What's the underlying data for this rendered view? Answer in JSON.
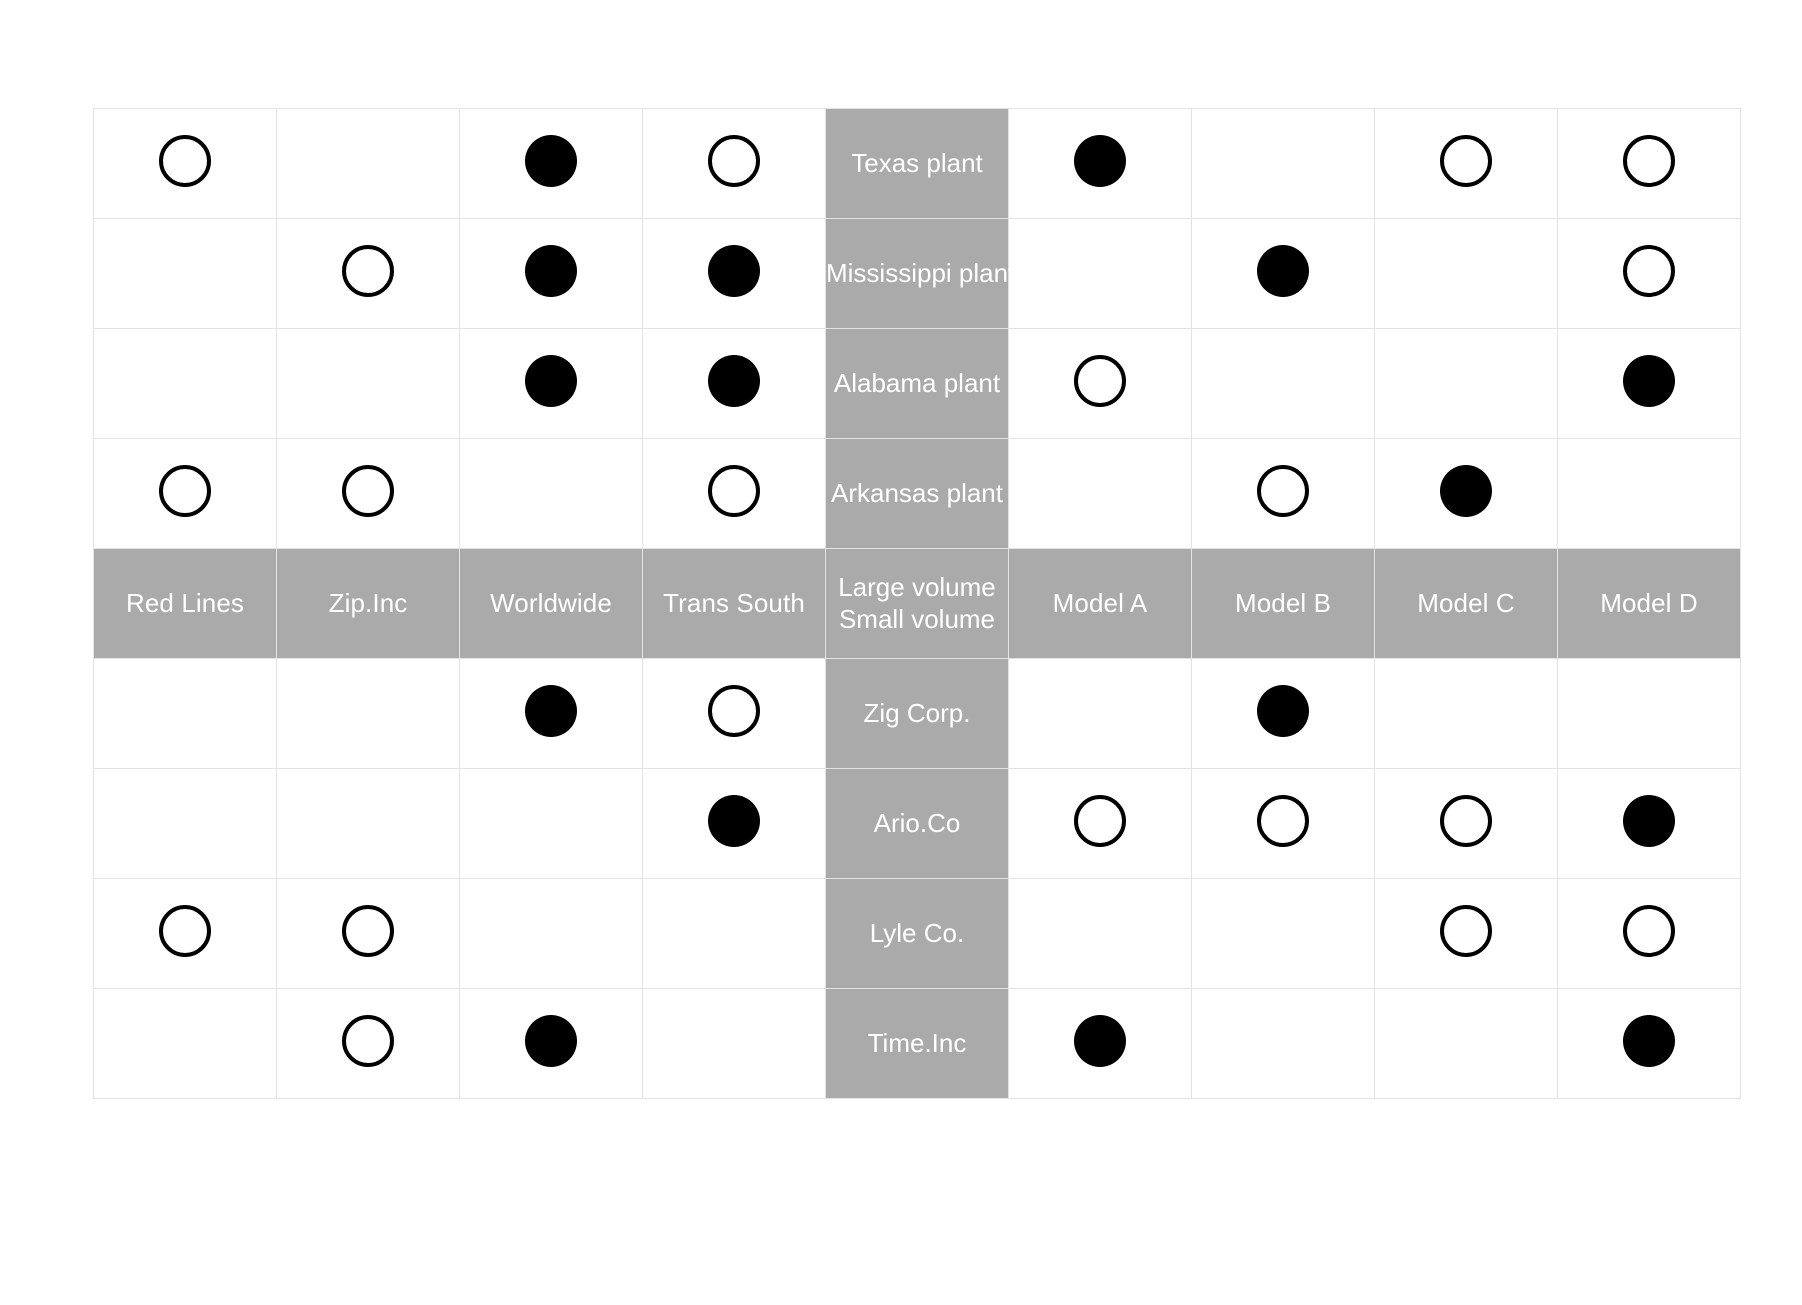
{
  "diagram": {
    "kind": "comparison-matrix",
    "colors": {
      "header_background": "#aaaaaa",
      "header_text": "#ffffff",
      "grid_line": "#e3e3e3",
      "marker_filled": "#000000",
      "marker_open_stroke": "#000000",
      "page_background": "#ffffff"
    },
    "marker_legend": {
      "filled": "filled-circle",
      "open": "open-circle",
      "none": "empty-cell"
    }
  },
  "center_column": {
    "header_line_1": "Large volume",
    "header_line_2": "Small volume",
    "top_labels": [
      "Texas plant",
      "Mississippi plant",
      "Alabama plant",
      "Arkansas plant"
    ],
    "bottom_labels": [
      "Zig Corp.",
      "Ario.Co",
      "Lyle Co.",
      "Time.Inc"
    ]
  },
  "left_columns": [
    "Red Lines",
    "Zip.Inc",
    "Worldwide",
    "Trans South"
  ],
  "right_columns": [
    "Model A",
    "Model B",
    "Model C",
    "Model D"
  ],
  "rows": [
    {
      "label": "Texas plant",
      "section": "top",
      "left": [
        "open",
        "none",
        "filled",
        "open"
      ],
      "right": [
        "filled",
        "none",
        "open",
        "open"
      ]
    },
    {
      "label": "Mississippi plant",
      "section": "top",
      "left": [
        "none",
        "open",
        "filled",
        "filled"
      ],
      "right": [
        "none",
        "filled",
        "none",
        "open"
      ]
    },
    {
      "label": "Alabama plant",
      "section": "top",
      "left": [
        "none",
        "none",
        "filled",
        "filled"
      ],
      "right": [
        "open",
        "none",
        "none",
        "filled"
      ]
    },
    {
      "label": "Arkansas plant",
      "section": "top",
      "left": [
        "open",
        "open",
        "none",
        "open"
      ],
      "right": [
        "none",
        "open",
        "filled",
        "none"
      ]
    },
    {
      "label": "Zig Corp.",
      "section": "bottom",
      "left": [
        "none",
        "none",
        "filled",
        "open"
      ],
      "right": [
        "none",
        "filled",
        "none",
        "none"
      ]
    },
    {
      "label": "Ario.Co",
      "section": "bottom",
      "left": [
        "none",
        "none",
        "none",
        "filled"
      ],
      "right": [
        "open",
        "open",
        "open",
        "filled"
      ]
    },
    {
      "label": "Lyle Co.",
      "section": "bottom",
      "left": [
        "open",
        "open",
        "none",
        "none"
      ],
      "right": [
        "none",
        "none",
        "open",
        "open"
      ]
    },
    {
      "label": "Time.Inc",
      "section": "bottom",
      "left": [
        "none",
        "open",
        "filled",
        "none"
      ],
      "right": [
        "filled",
        "none",
        "none",
        "filled"
      ]
    }
  ]
}
